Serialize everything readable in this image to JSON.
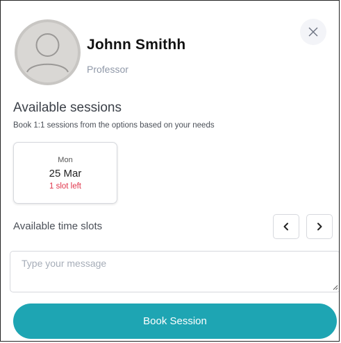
{
  "profile": {
    "name": "Johnn Smithh",
    "role": "Professor",
    "avatar_icon": "user-avatar-icon"
  },
  "close_icon": "close-icon",
  "sessions": {
    "title": "Available sessions",
    "subtitle": "Book 1:1 sessions from the options based on your needs",
    "dates": [
      {
        "day": "Mon",
        "date": "25 Mar",
        "slots": "1 slot left"
      }
    ]
  },
  "time_slots": {
    "label": "Available time slots",
    "prev_icon": "chevron-left-icon",
    "next_icon": "chevron-right-icon"
  },
  "message": {
    "placeholder": "Type your message",
    "value": ""
  },
  "book_button": {
    "label": "Book Session"
  },
  "colors": {
    "accent": "#1ea5b3",
    "slot_warning": "#e0344a",
    "muted_text": "#8f98a8"
  }
}
